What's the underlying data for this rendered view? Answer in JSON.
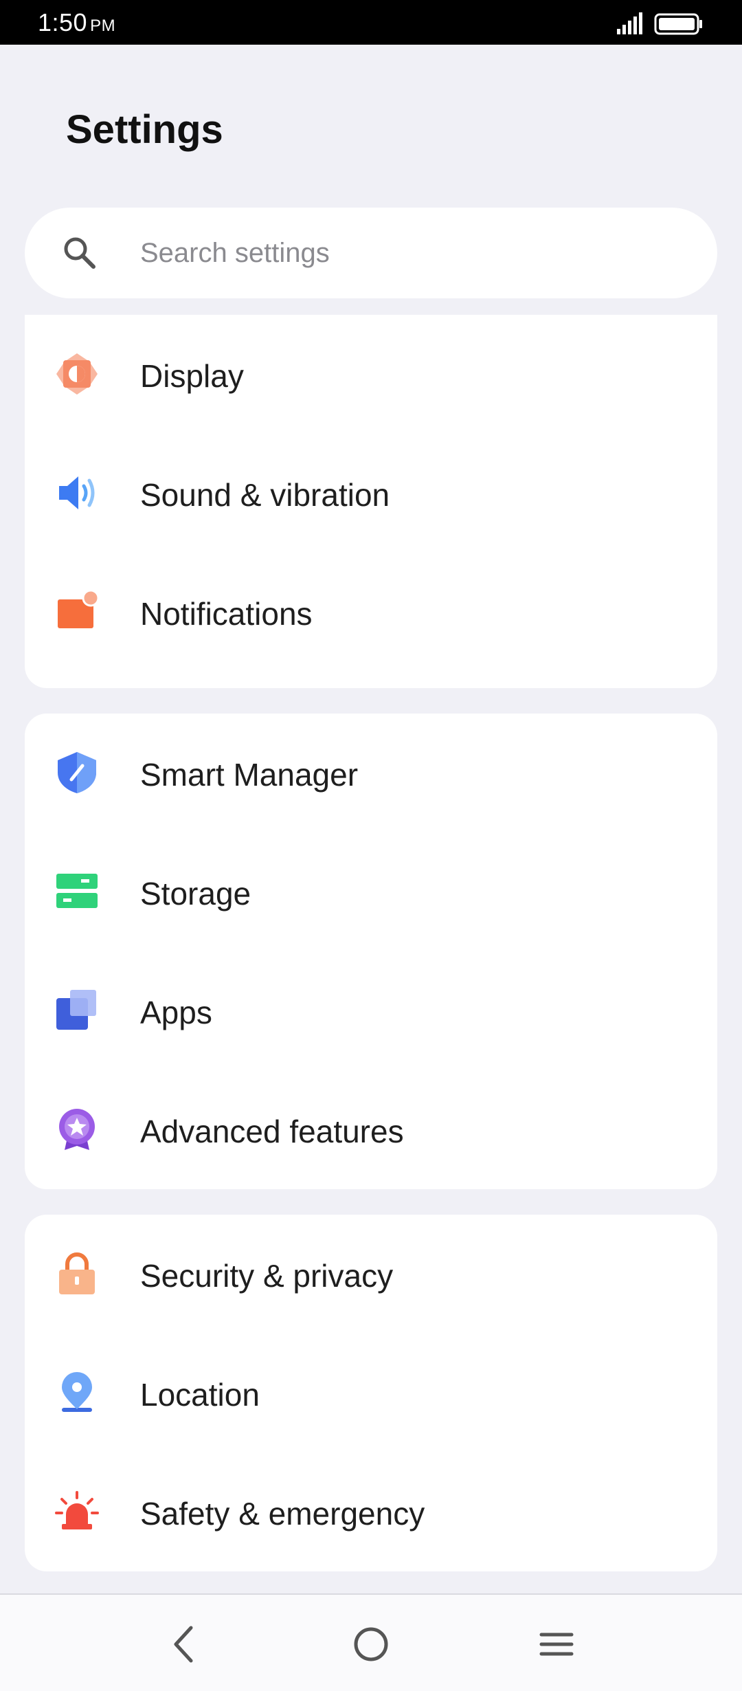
{
  "status_bar": {
    "time": "1:50",
    "ampm": "PM"
  },
  "header": {
    "title": "Settings"
  },
  "search": {
    "placeholder": "Search settings"
  },
  "groups": [
    {
      "items": [
        {
          "label": "Display",
          "icon": "display-icon"
        },
        {
          "label": "Sound & vibration",
          "icon": "sound-icon"
        },
        {
          "label": "Notifications",
          "icon": "notifications-icon"
        }
      ]
    },
    {
      "items": [
        {
          "label": "Smart Manager",
          "icon": "shield-icon"
        },
        {
          "label": "Storage",
          "icon": "storage-icon"
        },
        {
          "label": "Apps",
          "icon": "apps-icon"
        },
        {
          "label": "Advanced features",
          "icon": "star-badge-icon"
        }
      ]
    },
    {
      "items": [
        {
          "label": "Security & privacy",
          "icon": "lock-icon"
        },
        {
          "label": "Location",
          "icon": "location-pin-icon"
        },
        {
          "label": "Safety & emergency",
          "icon": "siren-icon"
        }
      ]
    }
  ],
  "navigation": {
    "back": "back-icon",
    "home": "home-icon",
    "menu": "menu-icon"
  }
}
